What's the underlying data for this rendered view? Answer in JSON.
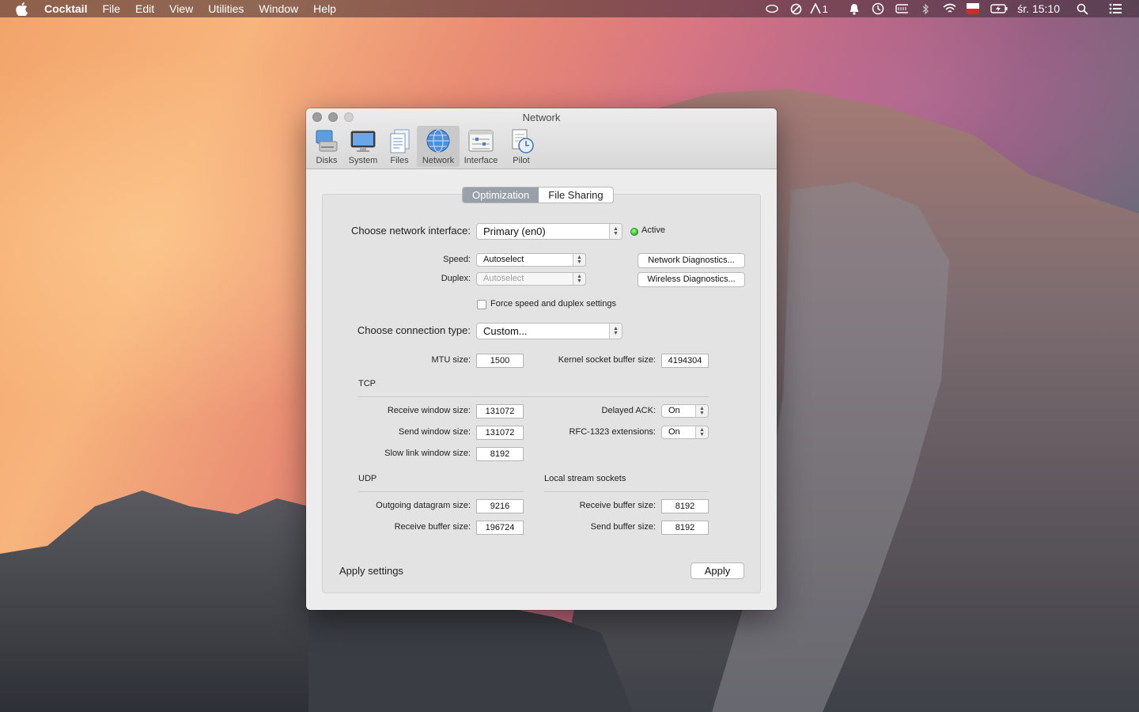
{
  "menubar": {
    "app_name": "Cocktail",
    "items": [
      "File",
      "Edit",
      "View",
      "Utilities",
      "Window",
      "Help"
    ],
    "status_number": "1",
    "clock": "śr. 15:10"
  },
  "window": {
    "title": "Network",
    "toolbar": [
      {
        "label": "Disks"
      },
      {
        "label": "System"
      },
      {
        "label": "Files"
      },
      {
        "label": "Network"
      },
      {
        "label": "Interface"
      },
      {
        "label": "Pilot"
      }
    ],
    "tabs": [
      "Optimization",
      "File Sharing"
    ],
    "interface": {
      "label": "Choose network interface:",
      "value": "Primary (en0)",
      "status": "Active"
    },
    "speed": {
      "label": "Speed:",
      "value": "Autoselect"
    },
    "duplex": {
      "label": "Duplex:",
      "value": "Autoselect"
    },
    "diag_buttons": [
      "Network Diagnostics...",
      "Wireless Diagnostics..."
    ],
    "force_checkbox": "Force speed and duplex settings",
    "connection": {
      "label": "Choose connection type:",
      "value": "Custom..."
    },
    "mtu": {
      "label": "MTU size:",
      "value": "1500"
    },
    "kernel": {
      "label": "Kernel socket buffer size:",
      "value": "4194304"
    },
    "tcp": {
      "heading": "TCP",
      "receive_window": {
        "label": "Receive window size:",
        "value": "131072"
      },
      "send_window": {
        "label": "Send window size:",
        "value": "131072"
      },
      "slow_link": {
        "label": "Slow link window size:",
        "value": "8192"
      },
      "delayed_ack": {
        "label": "Delayed ACK:",
        "value": "On"
      },
      "rfc1323": {
        "label": "RFC-1323 extensions:",
        "value": "On"
      }
    },
    "udp": {
      "heading": "UDP",
      "outgoing": {
        "label": "Outgoing datagram size:",
        "value": "9216"
      },
      "receive": {
        "label": "Receive buffer size:",
        "value": "196724"
      }
    },
    "local": {
      "heading": "Local stream sockets",
      "receive": {
        "label": "Receive buffer size:",
        "value": "8192"
      },
      "send": {
        "label": "Send buffer size:",
        "value": "8192"
      }
    },
    "apply": {
      "label": "Apply settings",
      "button": "Apply"
    }
  }
}
